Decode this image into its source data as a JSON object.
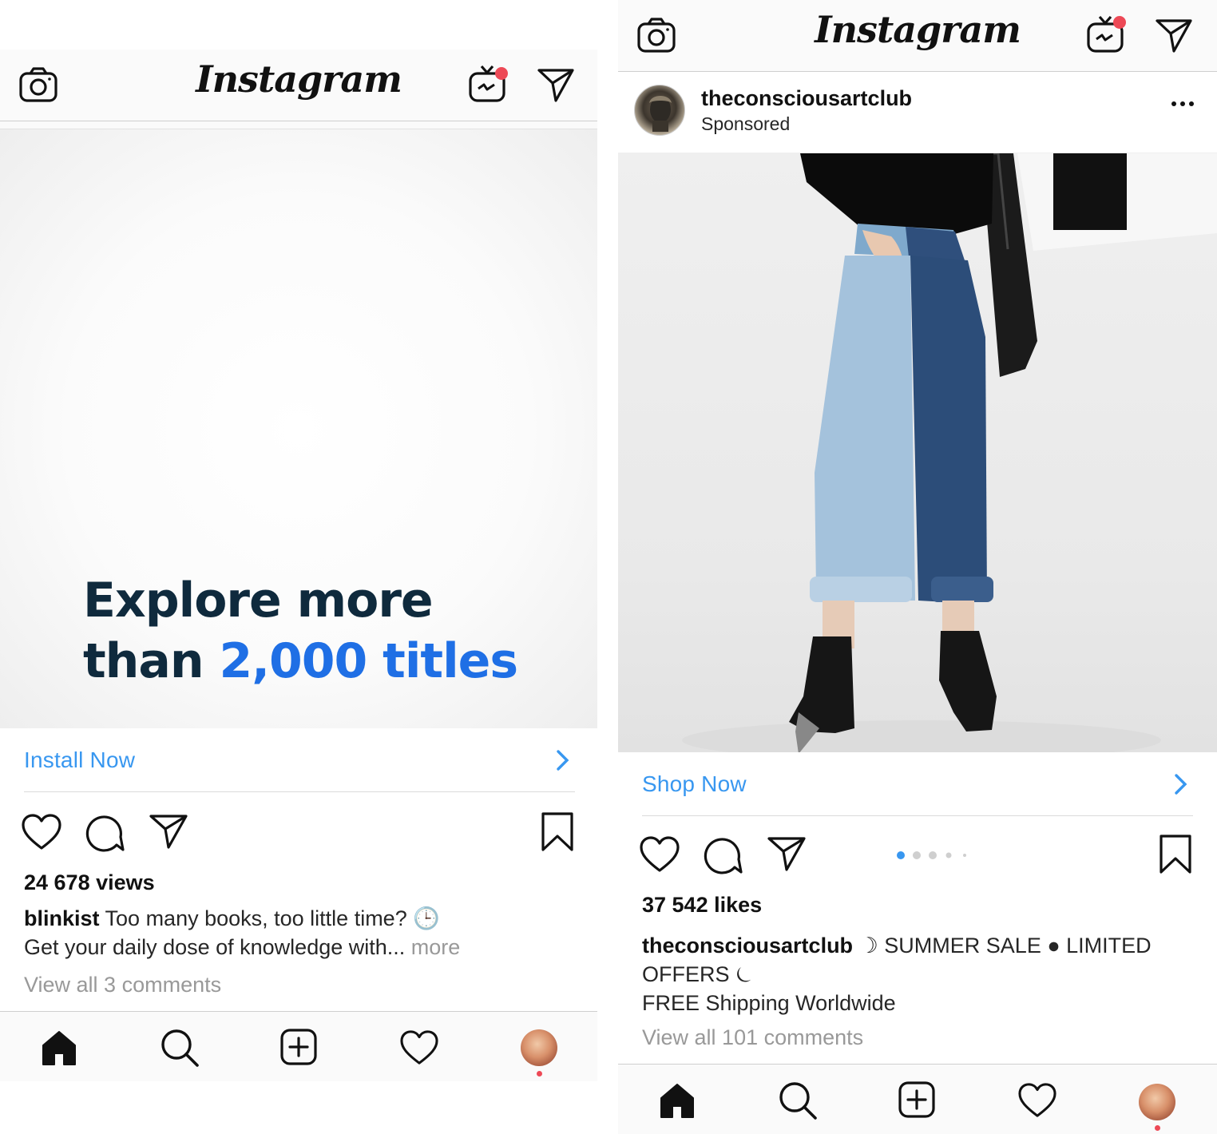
{
  "left": {
    "header": {
      "logo": "Instagram"
    },
    "ad": {
      "headline_line1": "Explore more",
      "headline_line2_prefix": "than",
      "headline_line2_highlight": "2,000 titles"
    },
    "cta": {
      "label": "Install Now"
    },
    "stats": {
      "views": "24 678 views"
    },
    "caption": {
      "username": "blinkist",
      "text_line1": "Too many books, too little time? 🕒",
      "text_line2": "Get your daily dose of knowledge with...",
      "more": "more"
    },
    "comments": {
      "view_all": "View all 3 comments"
    }
  },
  "right": {
    "header": {
      "logo": "Instagram"
    },
    "post": {
      "username": "theconsciousartclub",
      "subtitle": "Sponsored"
    },
    "cta": {
      "label": "Shop Now"
    },
    "stats": {
      "likes": "37 542 likes"
    },
    "caption": {
      "username": "theconsciousartclub",
      "text_line1": "☽ SUMMER SALE ● LIMITED",
      "text_line2": "OFFERS ⏾",
      "text_line3": "FREE Shipping Worldwide"
    },
    "comments": {
      "view_all": "View all 101 comments"
    },
    "carousel": {
      "total": 5,
      "active_index": 0
    }
  },
  "colors": {
    "link_blue": "#3897f0",
    "notification_red": "#ed4956",
    "headline_navy": "#0f2a3d",
    "headline_blue": "#1f6fe5"
  },
  "icons": {
    "top": [
      "camera-icon",
      "igtv-icon",
      "direct-message-icon"
    ],
    "actions": [
      "heart-icon",
      "comment-icon",
      "share-icon",
      "bookmark-icon"
    ],
    "bottom": [
      "home-icon",
      "search-icon",
      "add-post-icon",
      "activity-heart-icon",
      "profile-avatar"
    ]
  }
}
